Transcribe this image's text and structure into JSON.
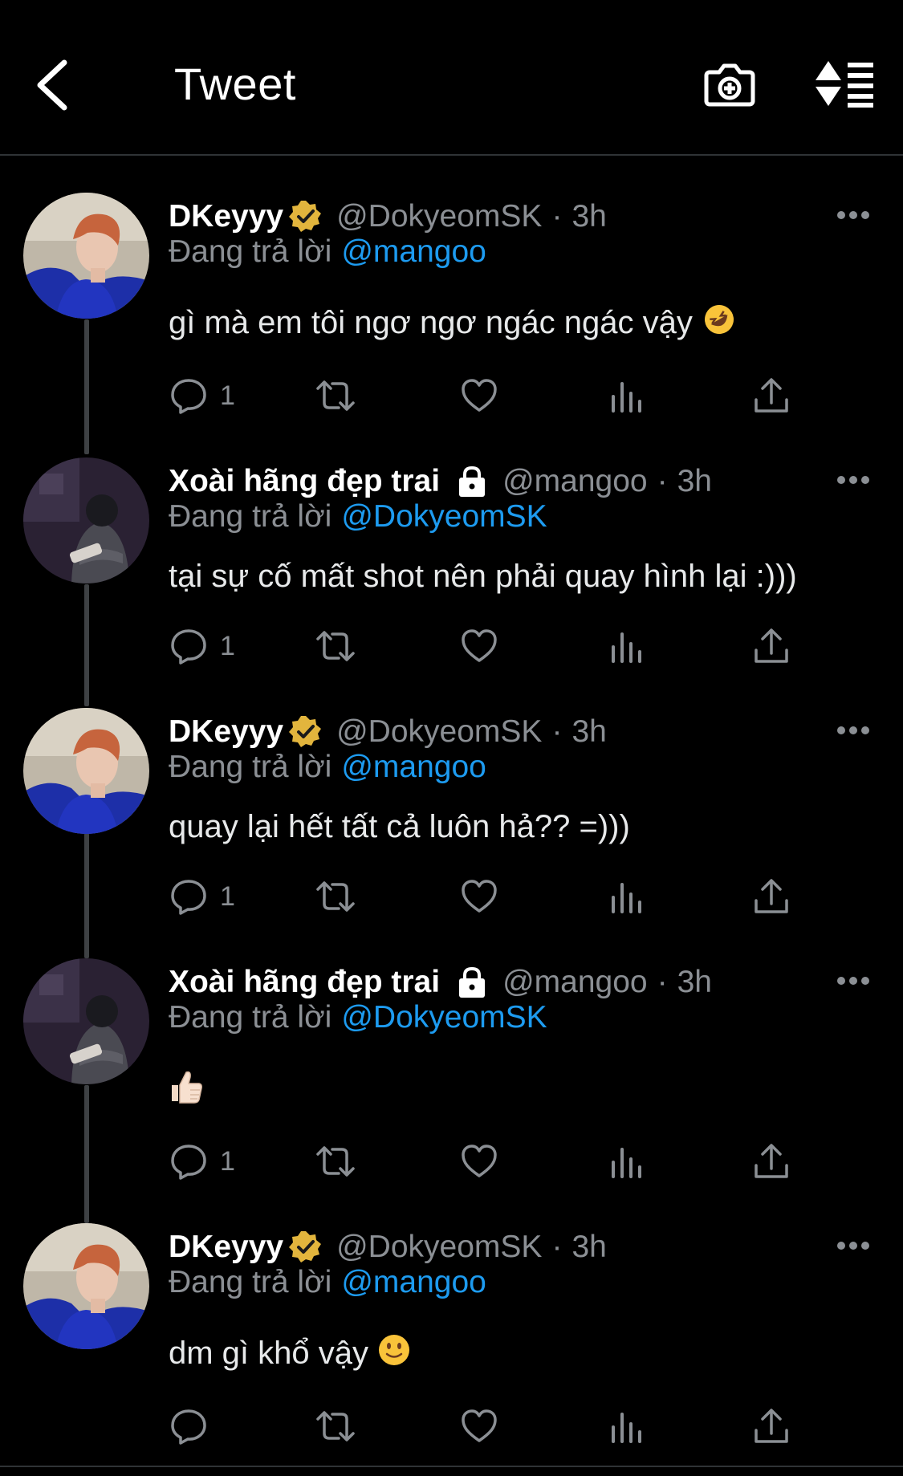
{
  "header": {
    "title": "Tweet"
  },
  "tweets": [
    {
      "name": "DKeyyy",
      "handle": "@DokyeomSK",
      "dot": "·",
      "time": "3h",
      "reply_label": "Đang trả lời",
      "reply_to": "@mangoo",
      "text": "gì mà em tôi ngơ ngơ ngác ngác vậy",
      "text_emoji": "rofl",
      "replies": "1",
      "badge": "verified",
      "avatar": "dkeyyy"
    },
    {
      "name": "Xoài hãng đẹp trai",
      "handle": "@mangoo",
      "dot": "·",
      "time": "3h",
      "reply_label": "Đang trả lời",
      "reply_to": "@DokyeomSK",
      "text": "tại sự cố mất shot nên phải quay hình lại :)))",
      "replies": "1",
      "badge": "lock",
      "avatar": "mangoo"
    },
    {
      "name": "DKeyyy",
      "handle": "@DokyeomSK",
      "dot": "·",
      "time": "3h",
      "reply_label": "Đang trả lời",
      "reply_to": "@mangoo",
      "text": "quay lại hết tất cả luôn hả?? =)))",
      "replies": "1",
      "badge": "verified",
      "avatar": "dkeyyy"
    },
    {
      "name": "Xoài hãng đẹp trai",
      "handle": "@mangoo",
      "dot": "·",
      "time": "3h",
      "reply_label": "Đang trả lời",
      "reply_to": "@DokyeomSK",
      "text": "",
      "text_emoji": "thumbs-up",
      "replies": "1",
      "badge": "lock",
      "avatar": "mangoo"
    },
    {
      "name": "DKeyyy",
      "handle": "@DokyeomSK",
      "dot": "·",
      "time": "3h",
      "reply_label": "Đang trả lời",
      "reply_to": "@mangoo",
      "text": "dm gì khổ vậy",
      "text_emoji": "slight-smile",
      "replies": "",
      "badge": "verified",
      "avatar": "dkeyyy"
    }
  ],
  "colors": {
    "background": "#000000",
    "link": "#1d9bf0",
    "muted": "#8b8f94",
    "verified": "#e2b53d"
  },
  "icons": [
    "back-arrow-icon",
    "camera-add-icon",
    "sort-lines-icon",
    "more-dots-icon",
    "reply-icon",
    "retweet-icon",
    "like-icon",
    "views-icon",
    "share-icon",
    "verified-badge-icon",
    "lock-icon"
  ]
}
